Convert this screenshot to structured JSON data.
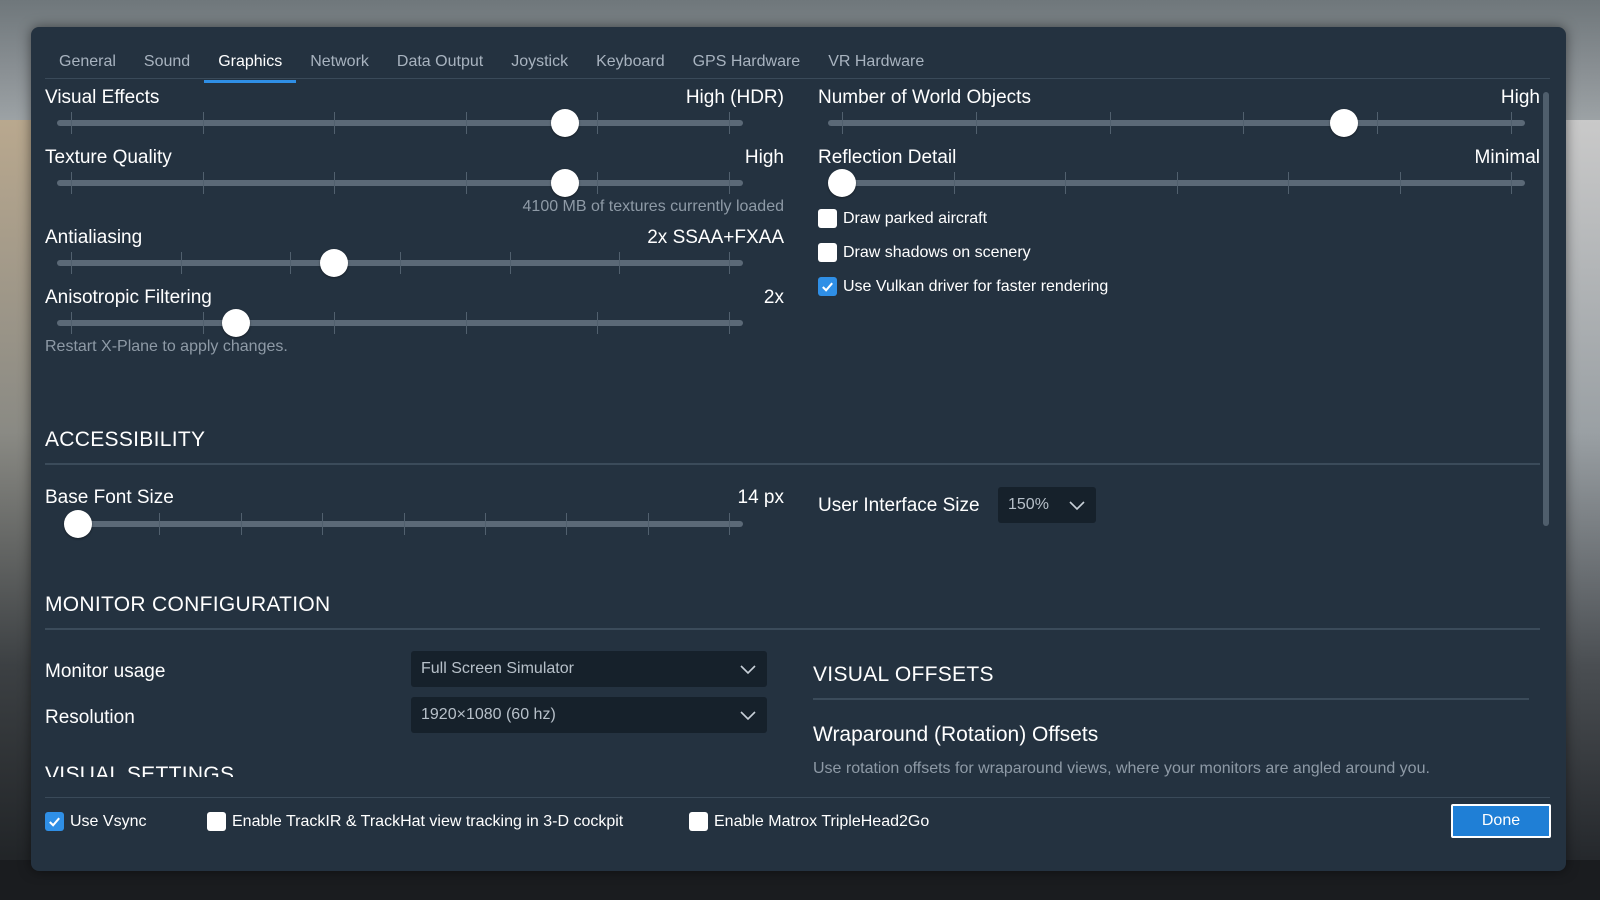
{
  "tabs": [
    {
      "label": "General"
    },
    {
      "label": "Sound"
    },
    {
      "label": "Graphics",
      "active": true
    },
    {
      "label": "Network"
    },
    {
      "label": "Data Output"
    },
    {
      "label": "Joystick"
    },
    {
      "label": "Keyboard"
    },
    {
      "label": "GPS Hardware"
    },
    {
      "label": "VR Hardware"
    }
  ],
  "graphics": {
    "visual_effects": {
      "label": "Visual Effects",
      "value": "High (HDR)",
      "level": 0.75
    },
    "texture_quality": {
      "label": "Texture Quality",
      "value": "High",
      "level": 0.75,
      "hint": "4100 MB of textures currently loaded"
    },
    "antialiasing": {
      "label": "Antialiasing",
      "value": "2x SSAA+FXAA",
      "level": 0.4
    },
    "anisotropic": {
      "label": "Anisotropic Filtering",
      "value": "2x",
      "level": 0.25
    },
    "restart_hint": "Restart X-Plane to apply changes.",
    "world_objects": {
      "label": "Number of World Objects",
      "value": "High",
      "level": 0.75
    },
    "reflection": {
      "label": "Reflection Detail",
      "value": "Minimal",
      "level": 0.0
    },
    "draw_parked": {
      "label": "Draw parked aircraft",
      "checked": false
    },
    "draw_shadows": {
      "label": "Draw shadows on scenery",
      "checked": false
    },
    "vulkan": {
      "label": "Use Vulkan driver for faster rendering",
      "checked": true
    }
  },
  "accessibility": {
    "heading": "ACCESSIBILITY",
    "base_font": {
      "label": "Base Font Size",
      "value": "14 px",
      "level": 0.0
    },
    "ui_size": {
      "label": "User Interface Size",
      "value": "150%"
    }
  },
  "monitor": {
    "heading": "MONITOR CONFIGURATION",
    "usage": {
      "label": "Monitor usage",
      "value": "Full Screen Simulator"
    },
    "resolution": {
      "label": "Resolution",
      "value": "1920×1080 (60 hz)"
    },
    "visual_settings_heading": "VISUAL SETTINGS"
  },
  "offsets": {
    "heading": "VISUAL OFFSETS",
    "subheading": "Wraparound (Rotation) Offsets",
    "description": "Use rotation offsets for wraparound views, where your monitors are angled around you."
  },
  "footer": {
    "vsync": {
      "label": "Use Vsync",
      "checked": true
    },
    "trackir": {
      "label": "Enable TrackIR & TrackHat view tracking in 3-D cockpit",
      "checked": false
    },
    "matrox": {
      "label": "Enable Matrox TripleHead2Go",
      "checked": false
    },
    "done": "Done"
  },
  "colors": {
    "accent": "#2f8fe6",
    "panel": "#243240",
    "done_button": "#1f7fd6"
  }
}
